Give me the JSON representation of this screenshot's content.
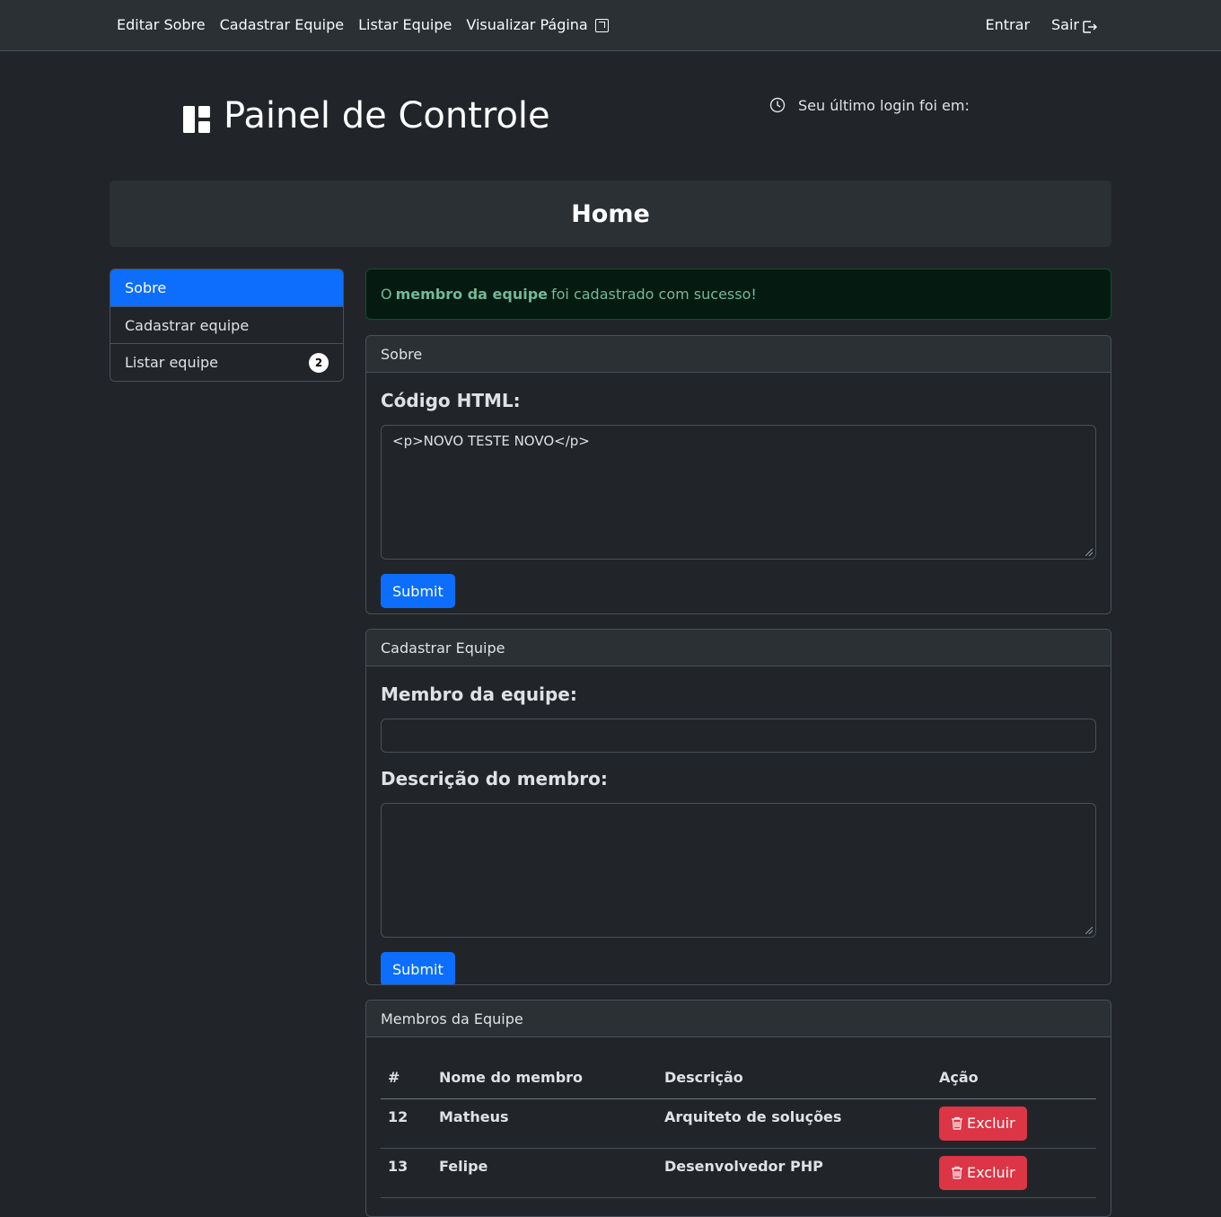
{
  "navbar": {
    "left": [
      "Editar Sobre",
      "Cadastrar Equipe",
      "Listar Equipe",
      "Visualizar Página"
    ],
    "right": [
      "Entrar",
      "Sair"
    ]
  },
  "header": {
    "title": "Painel de Controle",
    "last_login": "Seu último login foi em:"
  },
  "home": {
    "title": "Home"
  },
  "sidebar": {
    "items": [
      {
        "label": "Sobre",
        "active": true
      },
      {
        "label": "Cadastrar equipe"
      },
      {
        "label": "Listar equipe",
        "badge": "2"
      }
    ]
  },
  "alert": {
    "prefix": "O",
    "bold": "membro da equipe",
    "suffix": "foi cadastrado com sucesso!"
  },
  "sobre_card": {
    "header": "Sobre",
    "label": "Código HTML:",
    "value": "<p>NOVO TESTE NOVO</p>",
    "submit": "Submit"
  },
  "cadastrar_card": {
    "header": "Cadastrar Equipe",
    "member_label": "Membro da equipe:",
    "member_value": "",
    "desc_label": "Descrição do membro:",
    "desc_value": "",
    "submit": "Submit"
  },
  "membros_card": {
    "header": "Membros da Equipe",
    "columns": [
      "#",
      "Nome do membro",
      "Descrição",
      "Ação"
    ],
    "rows": [
      {
        "id": "12",
        "name": "Matheus",
        "desc": "Arquiteto de soluções",
        "action": "Excluir"
      },
      {
        "id": "13",
        "name": "Felipe",
        "desc": "Desenvolvedor PHP",
        "action": "Excluir"
      }
    ]
  },
  "colors": {
    "primary": "#0d6efd",
    "danger": "#dc3545",
    "success_text": "#75b798",
    "bg": "#212529"
  }
}
